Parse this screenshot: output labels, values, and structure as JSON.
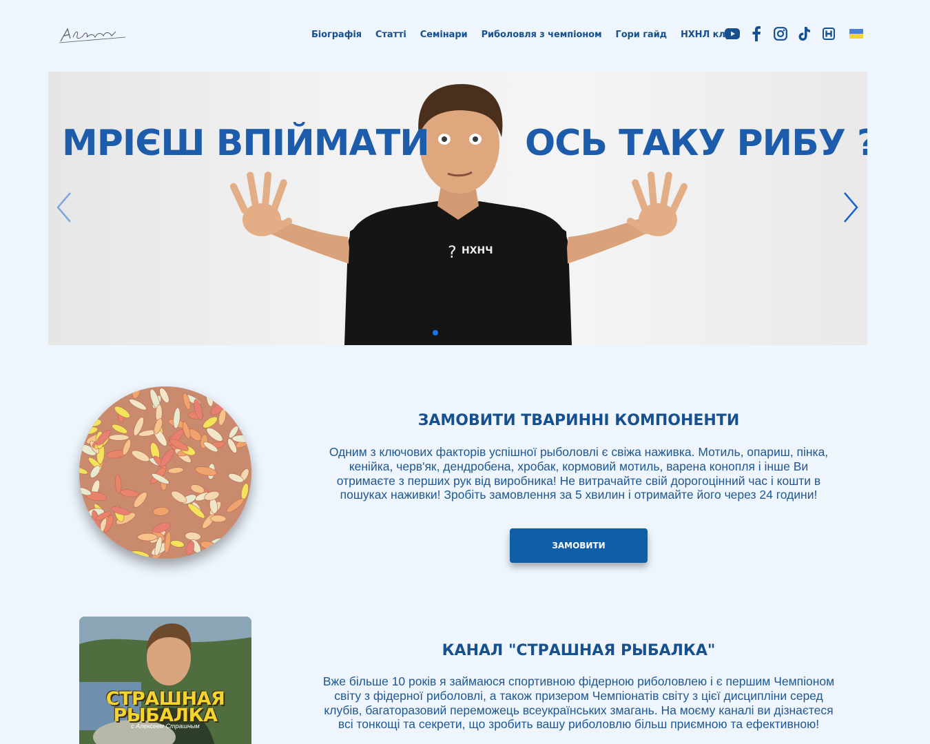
{
  "header": {
    "logo_text": "A.Strashnyj",
    "nav": [
      "Біографія",
      "Статті",
      "Семінари",
      "Риболовля з чемпіоном",
      "Гори гайд",
      "НХНЛ клуб"
    ],
    "social_icons": [
      "youtube-icon",
      "facebook-icon",
      "instagram-icon",
      "tiktok-icon",
      "h-club-icon",
      "ukraine-flag-icon"
    ]
  },
  "hero": {
    "text_left": "МРІЄШ ВПІЙМАТИ",
    "text_right": "ОСЬ ТАКУ РИБУ ?",
    "shirt_logo": "НХНЧ",
    "slides": 1,
    "active_slide": 0
  },
  "bait_section": {
    "title": "ЗАМОВИТИ ТВАРИННІ КОМПОНЕНТИ",
    "text": "Одним з ключових факторів успішної рыболовлі є свіжа наживка. Мотиль, опариш, пінка, кенійка, черв'як, дендробена, хробак, кормовий мотиль, варена конопля і інше Ви отримаєте з перших рук від виробника! Не витрачайте свій дорогоцінний час і кошти в пошуках наживки! Зробіть замовлення за 5 хвилин і отримайте його через 24 години!",
    "button": "ЗАМОВИТИ"
  },
  "channel_section": {
    "title": "КАНАЛ \"СТРАШНАЯ РЫБАЛКА\"",
    "text": "Вже більше 10 років я займаюся спортивною фідерною риболовлею і є першим Чемпіоном світу з фідерної риболовлі, а також призером Чемпіонатів світу з цієї дисципліни серед клубів, багаторазовий переможець всеукраїнських змагань. На моєму каналі ви дізнаєтеся всі тонкощі та секрети, що зробить вашу риболовлю більш приємною та ефективною!",
    "cover_line1": "СТРАШНАЯ",
    "cover_line2": "РЫБАЛКА",
    "cover_sub": "с Алексеем Страшным"
  },
  "colors": {
    "background": "#eef5fd",
    "brand_blue": "#16508f",
    "button_blue": "#0f5ea7",
    "hero_text": "#1c5cab"
  }
}
